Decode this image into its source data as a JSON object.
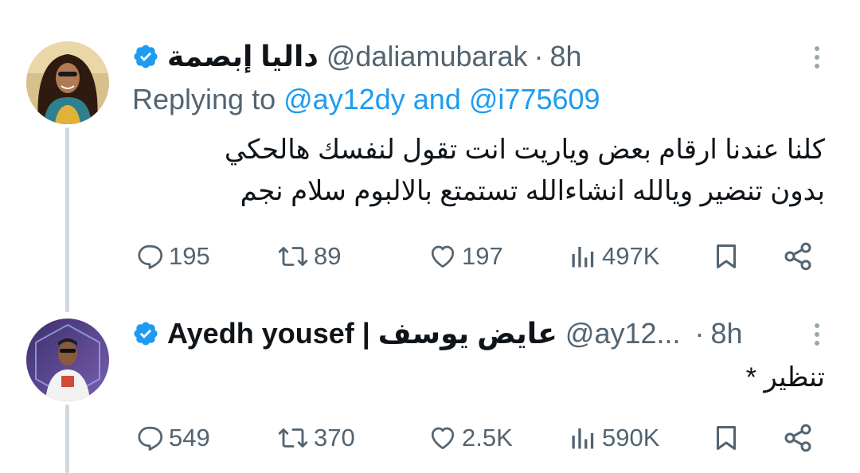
{
  "tweets": [
    {
      "display_name": "داليا إبصمة",
      "handle": "@daliamubarak",
      "separator": "·",
      "time": "8h",
      "replying_prefix": "Replying to",
      "replying_mention_1": "@ay12dy",
      "replying_and": "and",
      "replying_mention_2": "@i775609",
      "text_lines": [
        "كلنا عندنا ارقام بعض وياريت انت تقول لنفسك هالحكي",
        "بدون تنضير ويالله انشاءالله تستمتع بالالبوم سلام نجم"
      ],
      "stats": {
        "replies": "195",
        "reposts": "89",
        "likes": "197",
        "views": "497K"
      }
    },
    {
      "display_name": "Ayedh yousef | عايض يوسف",
      "handle": "@ay12...",
      "separator": "·",
      "time": "8h",
      "text_lines": [
        "تنظير *"
      ],
      "stats": {
        "replies": "549",
        "reposts": "370",
        "likes": "2.5K",
        "views": "590K"
      }
    }
  ],
  "icons": {
    "verified": "verified-badge-icon",
    "reply": "reply-bubble-icon",
    "repost": "repost-icon",
    "like": "heart-icon",
    "views": "views-bar-chart-icon",
    "bookmark": "bookmark-icon",
    "share": "share-icon",
    "more": "more-vertical-icon"
  },
  "colors": {
    "verified_blue": "#1d9bf0",
    "mention_blue": "#1d9bf0",
    "secondary_text": "#536471",
    "primary_text": "#0f1419",
    "thread_line": "#cfd9de"
  }
}
